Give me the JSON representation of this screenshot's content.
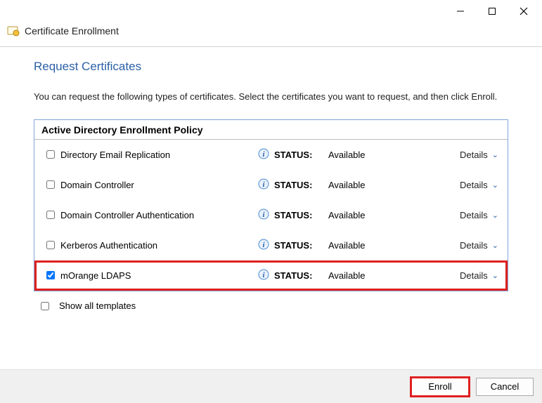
{
  "window": {
    "title": "Certificate Enrollment"
  },
  "page": {
    "heading": "Request Certificates",
    "description": "You can request the following types of certificates. Select the certificates you want to request, and then click Enroll."
  },
  "policy": {
    "name": "Active Directory Enrollment Policy",
    "status_label": "STATUS:",
    "details_label": "Details",
    "items": [
      {
        "name": "Directory Email Replication",
        "status": "Available",
        "checked": false,
        "highlight": false
      },
      {
        "name": "Domain Controller",
        "status": "Available",
        "checked": false,
        "highlight": false
      },
      {
        "name": "Domain Controller Authentication",
        "status": "Available",
        "checked": false,
        "highlight": false
      },
      {
        "name": "Kerberos Authentication",
        "status": "Available",
        "checked": false,
        "highlight": false
      },
      {
        "name": "mOrange LDAPS",
        "status": "Available",
        "checked": true,
        "highlight": true
      }
    ]
  },
  "options": {
    "show_all_label": "Show all templates",
    "show_all_checked": false
  },
  "buttons": {
    "enroll": "Enroll",
    "cancel": "Cancel"
  },
  "icons": {
    "info": "info-icon",
    "cert": "certificate-icon"
  },
  "colors": {
    "accent": "#2b5fa6",
    "highlight": "#e02020"
  }
}
